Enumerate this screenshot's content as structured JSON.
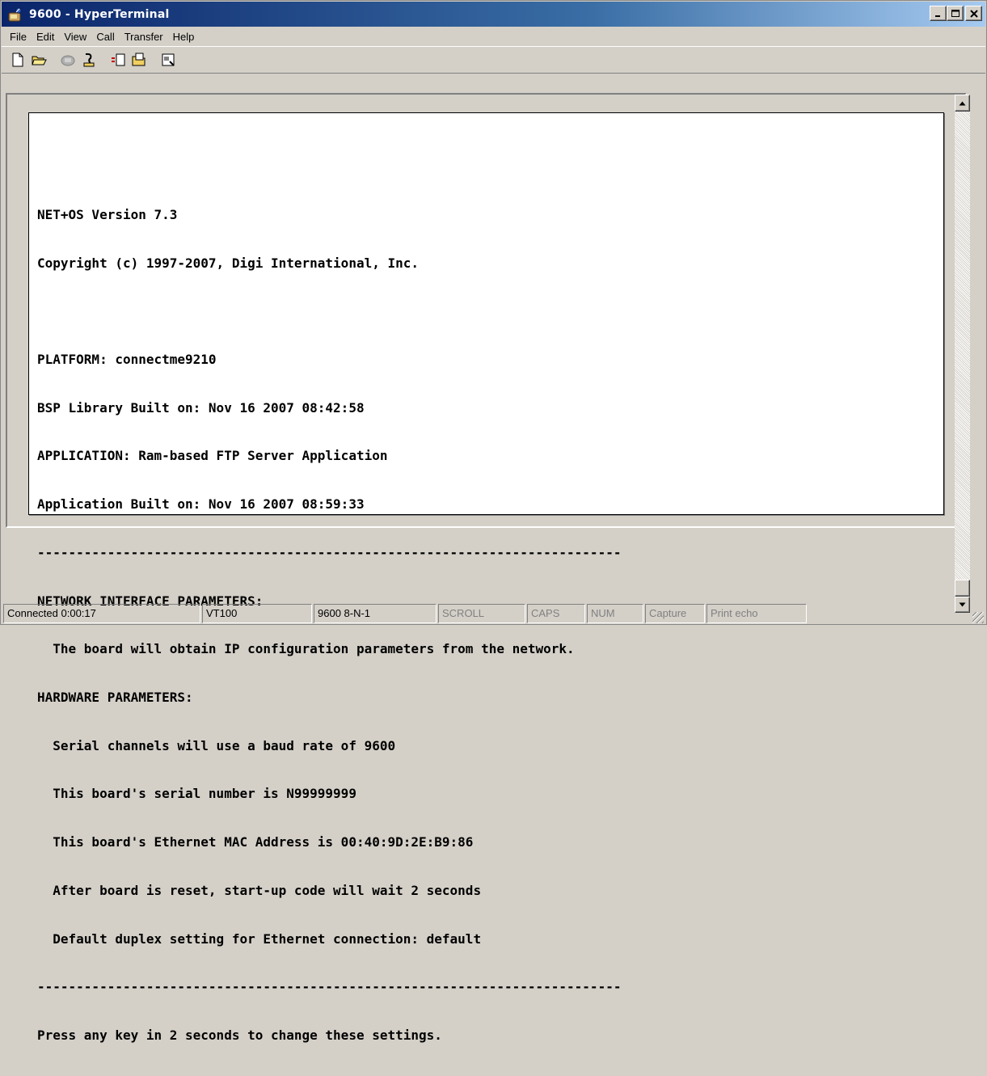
{
  "window": {
    "title": "9600 - HyperTerminal",
    "buttons": {
      "minimize": "_",
      "maximize": "□",
      "close": "×"
    }
  },
  "menubar": {
    "items": [
      "File",
      "Edit",
      "View",
      "Call",
      "Transfer",
      "Help"
    ]
  },
  "toolbar": {
    "buttons": [
      "new-document-icon",
      "open-folder-icon",
      "phone-icon",
      "disconnect-icon",
      "send-icon",
      "receive-icon",
      "properties-icon"
    ]
  },
  "terminal": {
    "lines": [
      "NET+OS Version 7.3",
      "Copyright (c) 1997-2007, Digi International, Inc.",
      "",
      "PLATFORM: connectme9210",
      "BSP Library Built on: Nov 16 2007 08:42:58",
      "APPLICATION: Ram-based FTP Server Application",
      "Application Built on: Nov 16 2007 08:59:33",
      "---------------------------------------------------------------------------",
      "NETWORK INTERFACE PARAMETERS:",
      "  The board will obtain IP configuration parameters from the network.",
      "HARDWARE PARAMETERS:",
      "  Serial channels will use a baud rate of 9600",
      "  This board's serial number is N99999999",
      "  This board's Ethernet MAC Address is 00:40:9D:2E:B9:86",
      "  After board is reset, start-up code will wait 2 seconds",
      "  Default duplex setting for Ethernet connection: default",
      "---------------------------------------------------------------------------",
      "Press any key in 2 seconds to change these settings."
    ]
  },
  "statusbar": {
    "connected": "Connected 0:00:17",
    "emulation": "VT100",
    "settings": "9600 8-N-1",
    "scroll": "SCROLL",
    "caps": "CAPS",
    "num": "NUM",
    "capture": "Capture",
    "print_echo": "Print echo"
  },
  "colors": {
    "title_start": "#0a246a",
    "title_end": "#a6caf0",
    "chrome": "#d4d0c8",
    "terminal_bg": "#ffffff"
  }
}
